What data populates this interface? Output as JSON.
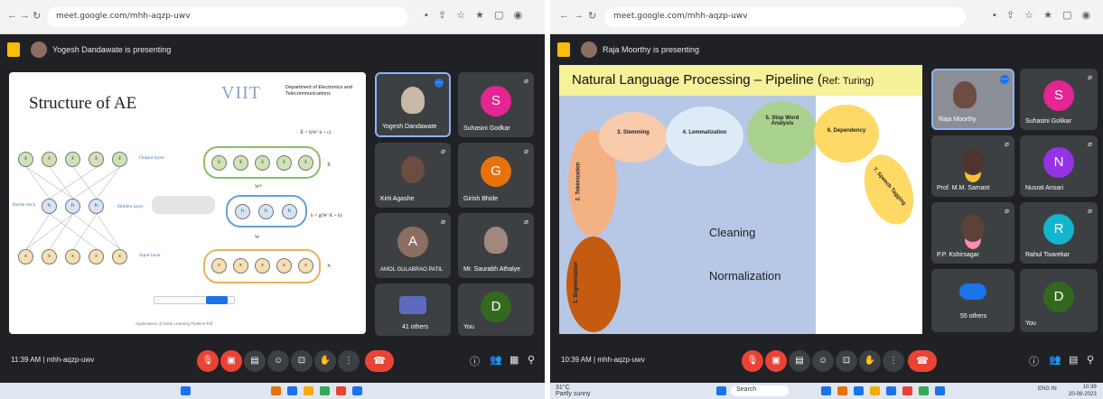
{
  "left": {
    "url": "meet.google.com/mhh-aqzp-uwv",
    "presenter": "Yogesh Dandawate is presenting",
    "slide": {
      "title": "Structure of AE",
      "institute": "VIIT",
      "department": "Department of Electronics and Telecommunications",
      "output_layer": "Output layer",
      "hidden_layer": "Hidden layer",
      "bottle_neck": "Bottle neck",
      "input_layer": "Input layer",
      "formula_top": "X̂ = f(W'·h + c)",
      "formula_mid": "h = g(W·X + b)",
      "x_hat": "X̂",
      "x": "X",
      "w_prime": "W*",
      "w": "W",
      "footer": "Applications of Deep Learning Pipeline Pdf"
    },
    "participants": [
      {
        "name": "Yogesh Dandawate",
        "avatar": ""
      },
      {
        "name": "Suhasini Godkar",
        "avatar": "S"
      },
      {
        "name": "Kirti Agashe",
        "avatar": ""
      },
      {
        "name": "Girish Bhide",
        "avatar": "G"
      },
      {
        "name": "AMOL GULABRAO PATIL",
        "avatar": "A"
      },
      {
        "name": "Mr. Saurabh Athalye",
        "avatar": ""
      },
      {
        "name": "41 others",
        "avatar": ""
      },
      {
        "name": "You",
        "avatar": "D"
      }
    ],
    "time": "11:39 AM",
    "meeting_code": "mhh-aqzp-uwv"
  },
  "right": {
    "url": "meet.google.com/mhh-aqzp-uwv",
    "presenter": "Raja Moorthy is presenting",
    "slide": {
      "title": "Natural Language Processing – Pipeline (",
      "ref": "Ref: Turing)",
      "steps": [
        "1. Segmentation",
        "2. Tokenization",
        "3. Stemming",
        "4. Lemmatization",
        "5. Stop Word Analysis",
        "6. Dependency",
        "7. Speech Tagging"
      ],
      "cleaning": "Cleaning",
      "normalization": "Normalization"
    },
    "participants": [
      {
        "name": "Raja Moorthy",
        "avatar": ""
      },
      {
        "name": "Suhasini Golikar",
        "avatar": "S"
      },
      {
        "name": "Prof. M.M. Samant",
        "avatar": ""
      },
      {
        "name": "Nusrat Ansari",
        "avatar": "N"
      },
      {
        "name": "P.P. Kshirsagar",
        "avatar": ""
      },
      {
        "name": "Rahul Tivarekar",
        "avatar": "R"
      },
      {
        "name": "55 others",
        "avatar": ""
      },
      {
        "name": "You",
        "avatar": "D"
      }
    ],
    "time": "10:39 AM",
    "meeting_code": "mhh-aqzp-uwv",
    "taskbar": {
      "weather_temp": "31°C",
      "weather_text": "Partly sunny",
      "search": "Search",
      "lang": "ENG IN",
      "clock_time": "10:39",
      "clock_date": "20-08-2023"
    }
  },
  "colors": {
    "meet_dark": "#202124",
    "tile": "#3c4043",
    "end_call": "#ea4335",
    "nlp_title_bg": "#f5f29a",
    "nlp_body_bg": "#b6c8e6"
  }
}
